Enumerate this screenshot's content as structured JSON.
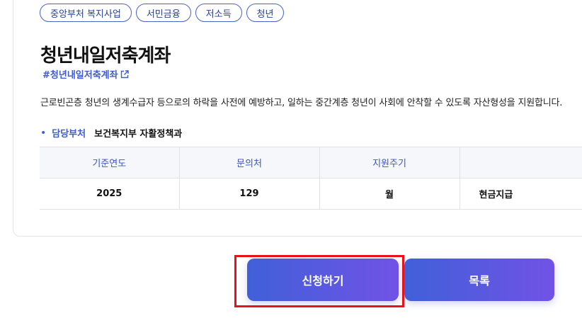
{
  "tags": [
    "중앙부처 복지사업",
    "서민금융",
    "저소득",
    "청년"
  ],
  "program": {
    "title": "청년내일저축계좌",
    "hashtag": "#청년내일저축계좌",
    "description": "근로빈곤층 청년의 생계수급자 등으로의 하락을 사전에 예방하고, 일하는 중간계층 청년이 사회에 안착할 수 있도록 자산형성을 지원합니다."
  },
  "department": {
    "label": "담당부처",
    "value": "보건복지부 자활정책과"
  },
  "table": {
    "headers": [
      "기준연도",
      "문의처",
      "지원주기",
      ""
    ],
    "row": [
      "2025",
      "129",
      "월",
      "현금지급"
    ]
  },
  "buttons": {
    "apply": "신청하기",
    "list": "목록"
  },
  "colors": {
    "accent": "#3f5bd0",
    "button_gradient_start": "#4060d8",
    "button_gradient_end": "#7152e6",
    "highlight": "#e8121a"
  },
  "icons": {
    "external_link": "external-link-icon"
  }
}
